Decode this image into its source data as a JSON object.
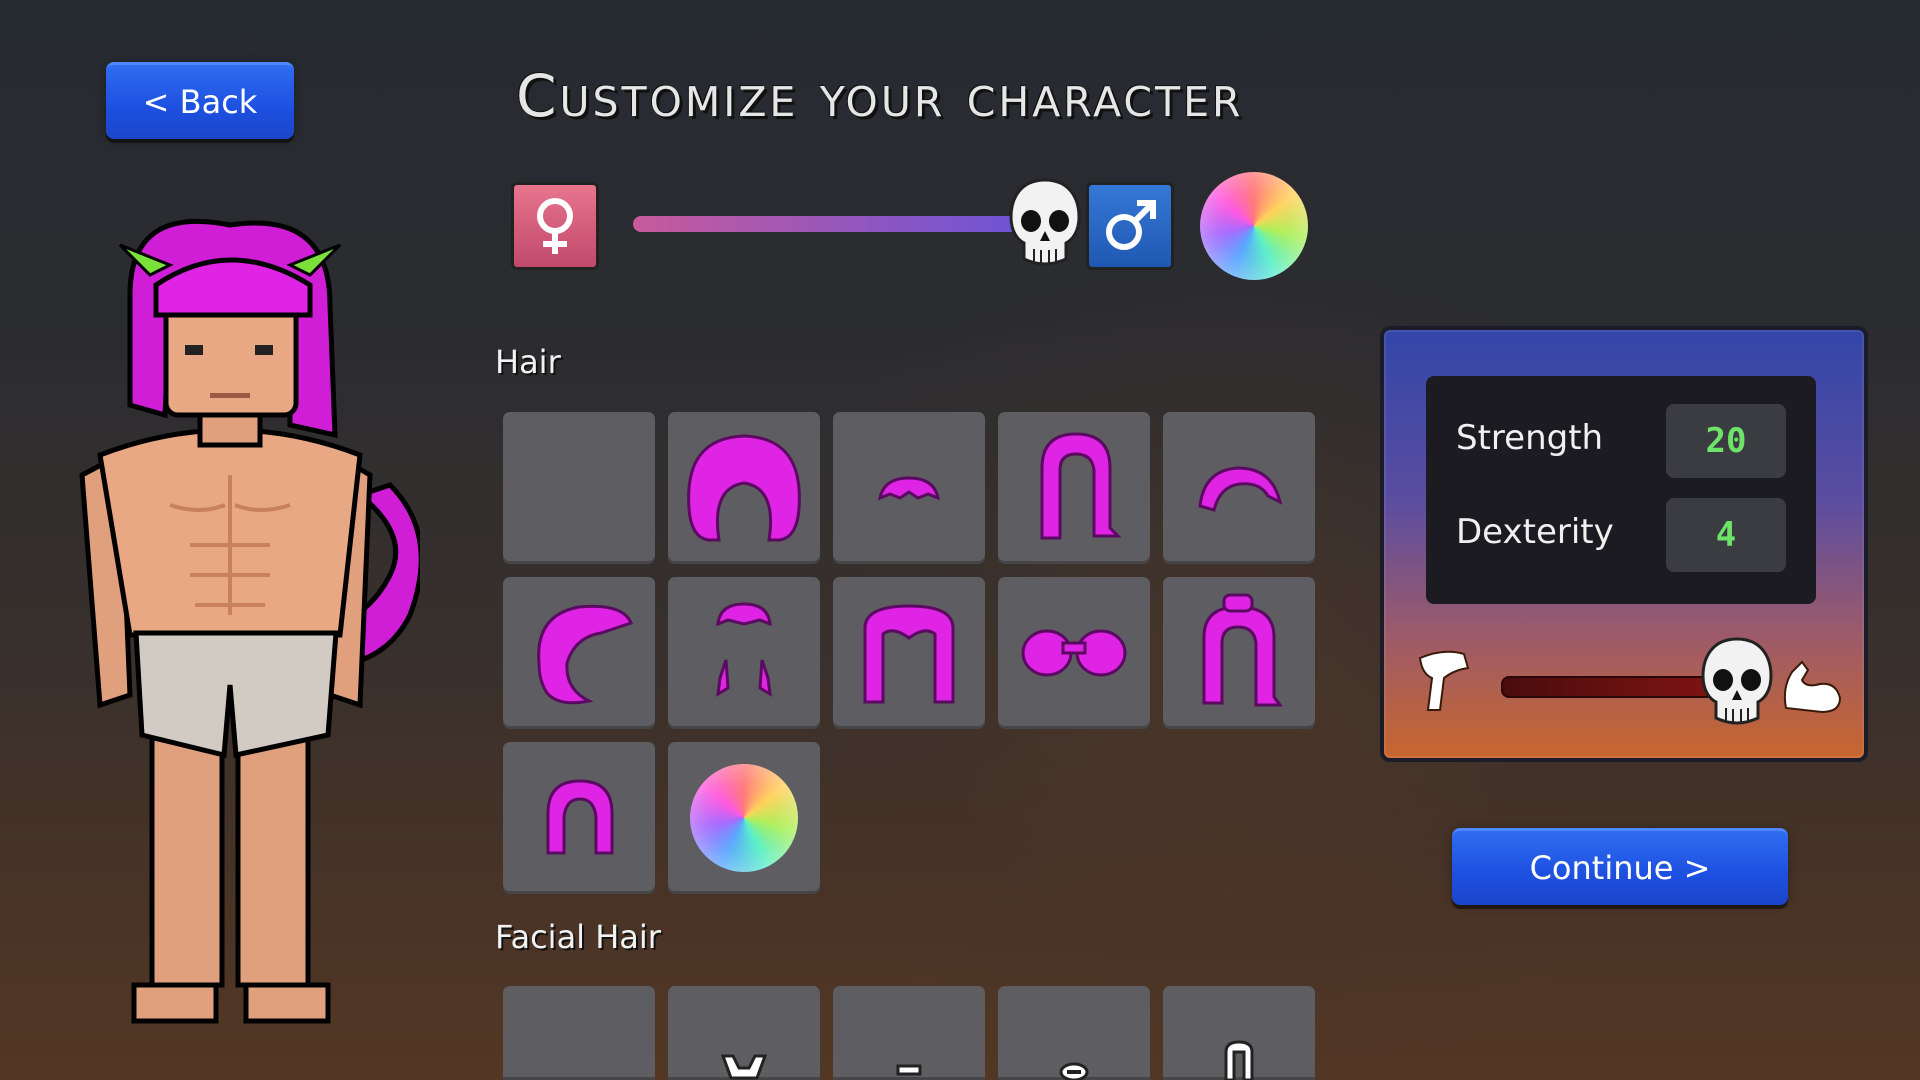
{
  "header": {
    "back_label": "< Back",
    "title": "Customize your character"
  },
  "gender": {
    "female_icon": "female-symbol",
    "male_icon": "male-symbol",
    "slider_value": 0.96,
    "body_color_icon": "color-wheel"
  },
  "sections": {
    "hair_label": "Hair",
    "facial_hair_label": "Facial Hair"
  },
  "hair_options": [
    "none",
    "afro",
    "short",
    "long",
    "swept",
    "wave",
    "sideburns",
    "parted-long",
    "buns",
    "ponytail",
    "curl",
    "color-picker"
  ],
  "facial_hair_options": [
    "none",
    "goatee",
    "mustache",
    "ring",
    "chin-strap"
  ],
  "stats": {
    "strength_label": "Strength",
    "strength_value": "20",
    "dexterity_label": "Dexterity",
    "dexterity_value": "4",
    "balance_value": 0.96
  },
  "footer": {
    "continue_label": "Continue >"
  },
  "colors": {
    "accent_blue": "#1d4fe0",
    "hair_magenta": "#e024e6",
    "stat_green": "#6ee36a",
    "tile_gray": "#5e5e62"
  }
}
